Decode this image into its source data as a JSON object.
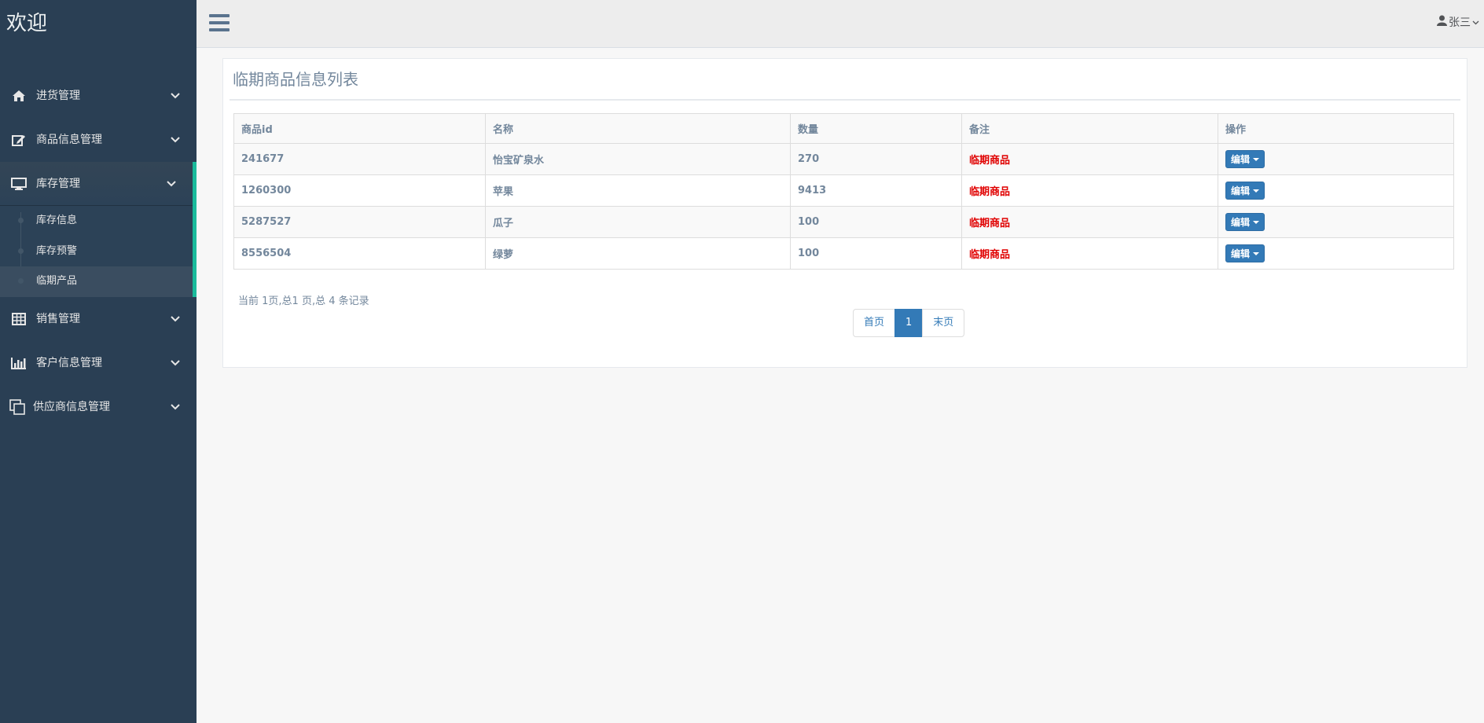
{
  "sidebar": {
    "brand": "欢迎",
    "menu": [
      {
        "label": "进货管理",
        "icon": "home-icon"
      },
      {
        "label": "商品信息管理",
        "icon": "edit-icon"
      },
      {
        "label": "库存管理",
        "icon": "desktop-icon",
        "active": true,
        "sub": [
          {
            "label": "库存信息"
          },
          {
            "label": "库存预警"
          },
          {
            "label": "临期产品",
            "current": true
          }
        ]
      },
      {
        "label": "销售管理",
        "icon": "table-icon"
      },
      {
        "label": "客户信息管理",
        "icon": "bar-chart-icon"
      },
      {
        "label": "供应商信息管理",
        "icon": "clone-icon"
      }
    ]
  },
  "topnav": {
    "user_name": "张三"
  },
  "main": {
    "title": "临期商品信息列表",
    "table": {
      "headers": [
        "商品id",
        "名称",
        "数量",
        "备注",
        "操作"
      ],
      "rows": [
        {
          "id": "241677",
          "name": "怡宝矿泉水",
          "qty": "270",
          "note": "临期商品",
          "action": "编辑"
        },
        {
          "id": "1260300",
          "name": "苹果",
          "qty": "9413",
          "note": "临期商品",
          "action": "编辑"
        },
        {
          "id": "5287527",
          "name": "瓜子",
          "qty": "100",
          "note": "临期商品",
          "action": "编辑"
        },
        {
          "id": "8556504",
          "name": "绿萝",
          "qty": "100",
          "note": "临期商品",
          "action": "编辑"
        }
      ]
    },
    "page_info": "当前 1页,总1 页,总 4 条记录",
    "pager": {
      "first": "首页",
      "current": "1",
      "last": "末页"
    }
  },
  "colors": {
    "sidebar_bg": "#2a3f54",
    "accent": "#1abb9c",
    "button": "#337ab7",
    "note": "#e00000"
  }
}
